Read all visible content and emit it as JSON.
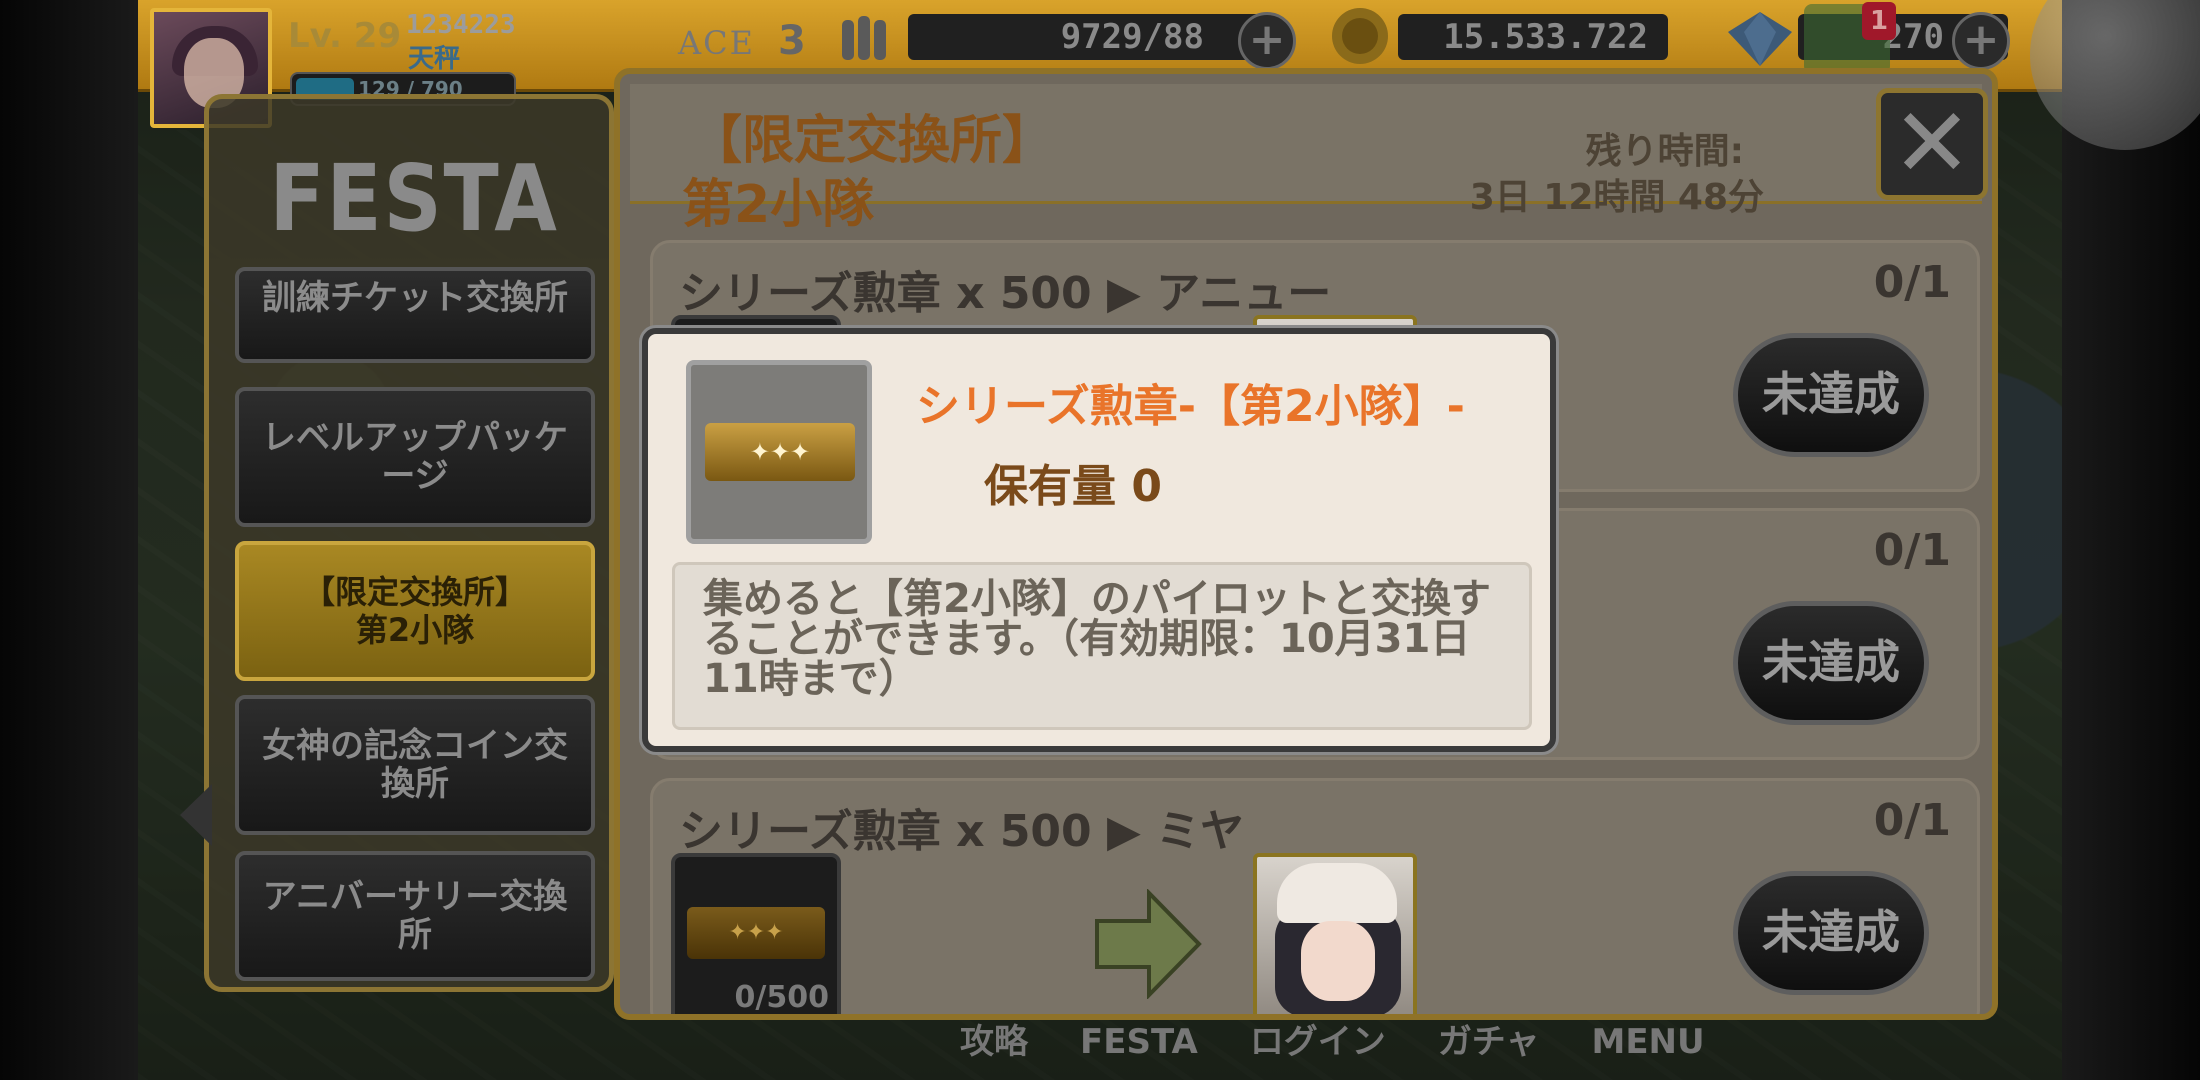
{
  "hud": {
    "level": "Lv. 29",
    "player_id": "1234223",
    "player_name": "天秤",
    "exp": "129 / 790",
    "ace_label": "ACE",
    "ace_value": "3",
    "ammo": "9729/88",
    "coins": "15.533.722",
    "gems": "270",
    "plus_symbol": "+",
    "notification_count": "1"
  },
  "sidebar": {
    "title": "FESTA",
    "items": [
      {
        "label": "訓練チケット交換所"
      },
      {
        "label": "レベルアップパッケージ"
      },
      {
        "label": "【限定交換所】\n第2小隊"
      },
      {
        "label": "女神の記念コイン交換所"
      },
      {
        "label": "アニバーサリー交換所"
      }
    ]
  },
  "panel": {
    "title_line1": "【限定交換所】",
    "title_line2": "第2小隊",
    "remaining_label": "残り時間:",
    "remaining_value": "3日 12時間 48分",
    "close_symbol": "✕",
    "rows": [
      {
        "title": "シリーズ勲章 x 500 ▶ アニュー",
        "count": "0/1",
        "status": "未達成"
      },
      {
        "title": "",
        "count": "0/1",
        "status": "未達成"
      },
      {
        "title": "シリーズ勲章 x 500 ▶ ミヤ",
        "count": "0/1",
        "status": "未達成",
        "slot_count": "0/500"
      }
    ]
  },
  "popup": {
    "item_name": "シリーズ勲章-【第2小隊】-",
    "holding": "保有量 0",
    "description": "集めると【第2小隊】のパイロットと交換することができます。（有効期限：10月31日11時まで）"
  },
  "bottom_nav": {
    "items": [
      "攻略",
      "FESTA",
      "ログイン",
      "ガチャ",
      "MENU"
    ]
  },
  "colors": {
    "accent_gold": "#d9a32b",
    "popup_title": "#e9742a",
    "popup_bg": "#f0e8de"
  }
}
